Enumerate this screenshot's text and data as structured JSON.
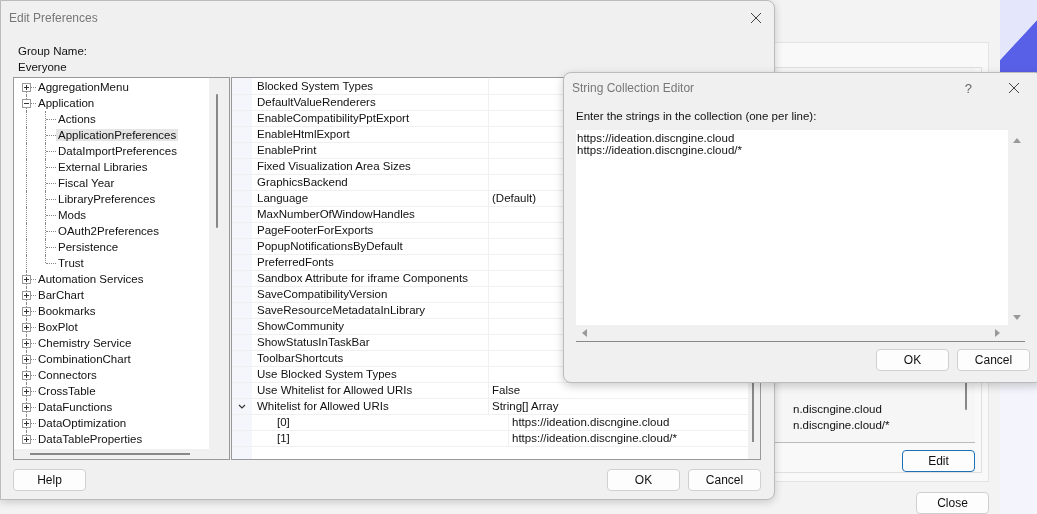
{
  "background_window": {
    "entries": [
      "n.discngine.cloud",
      "n.discngine.cloud/*"
    ],
    "edit_button": "Edit",
    "close_button": "Close"
  },
  "edit_preferences": {
    "title": "Edit Preferences",
    "group_name_label": "Group Name:",
    "group_name": "Everyone",
    "tree": [
      {
        "label": "AggregationMenu",
        "expanded": false,
        "selected": false
      },
      {
        "label": "Application",
        "expanded": true,
        "selected": false,
        "children": [
          {
            "label": "Actions",
            "selected": false
          },
          {
            "label": "ApplicationPreferences",
            "selected": true
          },
          {
            "label": "DataImportPreferences",
            "selected": false
          },
          {
            "label": "External Libraries",
            "selected": false
          },
          {
            "label": "Fiscal Year",
            "selected": false
          },
          {
            "label": "LibraryPreferences",
            "selected": false
          },
          {
            "label": "Mods",
            "selected": false
          },
          {
            "label": "OAuth2Preferences",
            "selected": false
          },
          {
            "label": "Persistence",
            "selected": false
          },
          {
            "label": "Trust",
            "selected": false
          }
        ]
      },
      {
        "label": "Automation Services",
        "expanded": false,
        "selected": false
      },
      {
        "label": "BarChart",
        "expanded": false,
        "selected": false
      },
      {
        "label": "Bookmarks",
        "expanded": false,
        "selected": false
      },
      {
        "label": "BoxPlot",
        "expanded": false,
        "selected": false
      },
      {
        "label": "Chemistry Service",
        "expanded": false,
        "selected": false
      },
      {
        "label": "CombinationChart",
        "expanded": false,
        "selected": false
      },
      {
        "label": "Connectors",
        "expanded": false,
        "selected": false
      },
      {
        "label": "CrossTable",
        "expanded": false,
        "selected": false
      },
      {
        "label": "DataFunctions",
        "expanded": false,
        "selected": false
      },
      {
        "label": "DataOptimization",
        "expanded": false,
        "selected": false
      },
      {
        "label": "DataTableProperties",
        "expanded": false,
        "selected": false
      }
    ],
    "properties": [
      {
        "name": "Blocked System Types"
      },
      {
        "name": "DefaultValueRenderers"
      },
      {
        "name": "EnableCompatibilityPptExport"
      },
      {
        "name": "EnableHtmlExport"
      },
      {
        "name": "EnablePrint"
      },
      {
        "name": "Fixed Visualization Area Sizes"
      },
      {
        "name": "GraphicsBackend"
      },
      {
        "name": "Language",
        "value": "(Default)"
      },
      {
        "name": "MaxNumberOfWindowHandles"
      },
      {
        "name": "PageFooterForExports"
      },
      {
        "name": "PopupNotificationsByDefault"
      },
      {
        "name": "PreferredFonts"
      },
      {
        "name": "Sandbox Attribute for iframe Components"
      },
      {
        "name": "SaveCompatibilityVersion"
      },
      {
        "name": "SaveResourceMetadataInLibrary"
      },
      {
        "name": "ShowCommunity"
      },
      {
        "name": "ShowStatusInTaskBar"
      },
      {
        "name": "ToolbarShortcuts"
      },
      {
        "name": "Use Blocked System Types"
      },
      {
        "name": "Use Whitelist for Allowed URIs",
        "value": "False"
      },
      {
        "name": "Whitelist for Allowed URIs",
        "value": "String[] Array",
        "expanded": true,
        "children": [
          {
            "name": "[0]",
            "value": "https://ideation.discngine.cloud"
          },
          {
            "name": "[1]",
            "value": "https://ideation.discngine.cloud/*"
          }
        ]
      }
    ],
    "help_button": "Help",
    "buttons": [
      "OK",
      "Cancel"
    ]
  },
  "string_editor": {
    "title": "String Collection Editor",
    "help": "?",
    "prompt": "Enter the strings in the collection (one per line):",
    "lines": [
      "https://ideation.discngine.cloud",
      "https://ideation.discngine.cloud/*"
    ],
    "buttons": [
      "OK",
      "Cancel"
    ]
  }
}
